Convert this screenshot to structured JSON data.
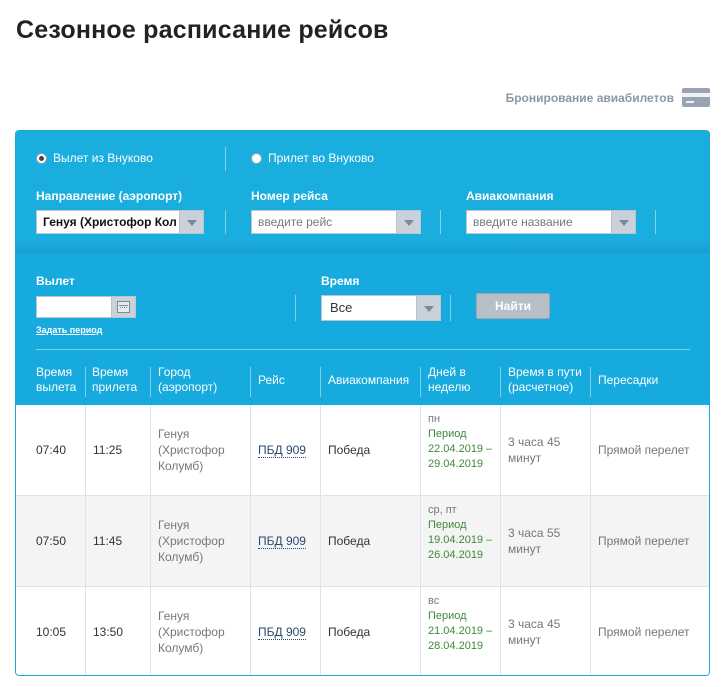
{
  "page": {
    "title": "Сезонное расписание рейсов"
  },
  "booking": {
    "label": "Бронирование авиабилетов",
    "icon": "credit-card-icon"
  },
  "filters": {
    "departure_radio": "Вылет из Внуково",
    "arrival_radio": "Прилет во Внуково",
    "direction_label": "Направление (аэропорт)",
    "direction_value": "Генуя (Христофор Кол",
    "flight_label": "Номер рейса",
    "flight_placeholder": "введите рейс",
    "airline_label": "Авиакомпания",
    "airline_placeholder": "введите название",
    "departure_label": "Вылет",
    "departure_value": "",
    "period_link": "Задать период",
    "time_label": "Время",
    "time_value": "Все",
    "search_button": "Найти"
  },
  "table": {
    "headers": {
      "dep": [
        "Время",
        "вылета"
      ],
      "arr": [
        "Время",
        "прилета"
      ],
      "city": [
        "Город",
        "(аэропорт)"
      ],
      "flight": [
        "Рейс"
      ],
      "airline": [
        "Авиакомпания"
      ],
      "days": [
        "Дней в",
        "неделю"
      ],
      "duration": [
        "Время в пути",
        "(расчетное)"
      ],
      "transfers": [
        "Пересадки"
      ]
    },
    "rows": [
      {
        "dep": "07:40",
        "arr": "11:25",
        "city": [
          "Генуя",
          "(Христофор",
          "Колумб)"
        ],
        "flight": "ПБД 909",
        "airline": "Победа",
        "days": "пн",
        "period_label": "Период",
        "period_range": [
          "22.04.2019 –",
          "29.04.2019"
        ],
        "duration": [
          "3 часа 45",
          "минут"
        ],
        "transfers": "Прямой перелет"
      },
      {
        "dep": "07:50",
        "arr": "11:45",
        "city": [
          "Генуя",
          "(Христофор",
          "Колумб)"
        ],
        "flight": "ПБД 909",
        "airline": "Победа",
        "days": "ср, пт",
        "period_label": "Период",
        "period_range": [
          "19.04.2019 –",
          "26.04.2019"
        ],
        "duration": [
          "3 часа 55",
          "минут"
        ],
        "transfers": "Прямой перелет"
      },
      {
        "dep": "10:05",
        "arr": "13:50",
        "city": [
          "Генуя",
          "(Христофор",
          "Колумб)"
        ],
        "flight": "ПБД 909",
        "airline": "Победа",
        "days": "вс",
        "period_label": "Период",
        "period_range": [
          "21.04.2019 –",
          "28.04.2019"
        ],
        "duration": [
          "3 часа 45",
          "минут"
        ],
        "transfers": "Прямой перелет"
      }
    ]
  }
}
